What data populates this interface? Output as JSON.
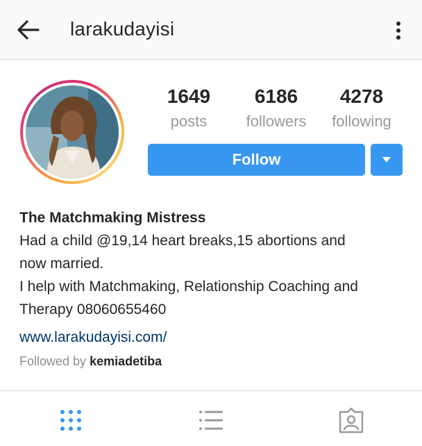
{
  "header": {
    "username": "larakudayisi",
    "back_icon": "arrow-left-icon",
    "more_icon": "more-vertical-icon"
  },
  "stats": {
    "posts": {
      "value": "1649",
      "label": "posts"
    },
    "followers": {
      "value": "6186",
      "label": "followers"
    },
    "following": {
      "value": "4278",
      "label": "following"
    }
  },
  "actions": {
    "follow_label": "Follow",
    "dropdown_icon": "caret-down-icon",
    "accent_color": "#3897f0"
  },
  "bio": {
    "full_name": "The Matchmaking Mistress",
    "lines": [
      "Had a child @19,14 heart breaks,15 abortions and",
      "now married.",
      "I help with Matchmaking, Relationship Coaching and",
      "Therapy 08060655460"
    ],
    "website": "www.larakudayisi.com/",
    "followed_by_prefix": "Followed by",
    "followed_by_user": "kemiadetiba"
  },
  "tabs": [
    {
      "icon": "grid-icon",
      "active": true
    },
    {
      "icon": "list-icon",
      "active": false
    },
    {
      "icon": "tagged-photos-icon",
      "active": false
    }
  ]
}
